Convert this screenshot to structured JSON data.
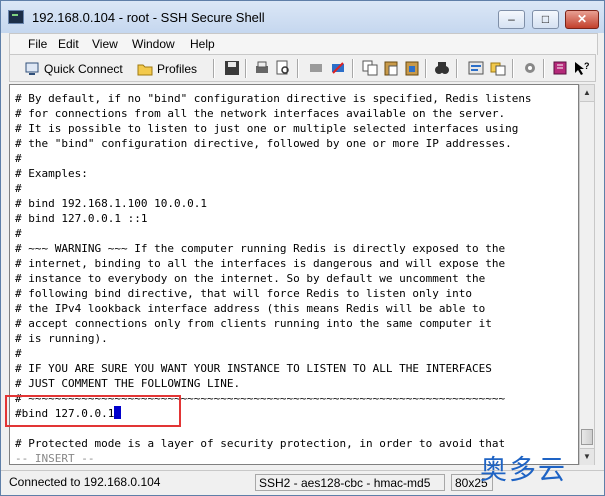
{
  "window": {
    "title": "192.168.0.104 - root - SSH Secure Shell",
    "controls": {
      "minimize": "–",
      "maximize": "□",
      "close": "✕"
    }
  },
  "menu": {
    "items": [
      "File",
      "Edit",
      "View",
      "Window",
      "Help"
    ]
  },
  "toolbar": {
    "quick_connect_label": "Quick Connect",
    "profiles_label": "Profiles",
    "icons": [
      "save-icon",
      "print-icon",
      "print-preview-icon",
      "disconnect-icon",
      "connect-icon",
      "copy-icon",
      "paste-icon",
      "paste-special-icon",
      "find-icon",
      "settings-icon",
      "file-transfer-icon",
      "options-icon",
      "help-book-icon",
      "context-help-icon"
    ]
  },
  "terminal": {
    "lines": [
      "# By default, if no \"bind\" configuration directive is specified, Redis listens",
      "# for connections from all the network interfaces available on the server.",
      "# It is possible to listen to just one or multiple selected interfaces using",
      "# the \"bind\" configuration directive, followed by one or more IP addresses.",
      "#",
      "# Examples:",
      "#",
      "# bind 192.168.1.100 10.0.0.1",
      "# bind 127.0.0.1 ::1",
      "#",
      "# ~~~ WARNING ~~~ If the computer running Redis is directly exposed to the",
      "# internet, binding to all the interfaces is dangerous and will expose the",
      "# instance to everybody on the internet. So by default we uncomment the",
      "# following bind directive, that will force Redis to listen only into",
      "# the IPv4 lookback interface address (this means Redis will be able to",
      "# accept connections only from clients running into the same computer it",
      "# is running).",
      "#",
      "# IF YOU ARE SURE YOU WANT YOUR INSTANCE TO LISTEN TO ALL THE INTERFACES",
      "# JUST COMMENT THE FOLLOWING LINE.",
      "# ~~~~~~~~~~~~~~~~~~~~~~~~~~~~~~~~~~~~~~~~~~~~~~~~~~~~~~~~~~~~~~~~~~~~~~~~",
      "#bind 127.0.0.1",
      "",
      "# Protected mode is a layer of security protection, in order to avoid that",
      "-- INSERT --"
    ],
    "cursor_line": "#bind 127.0.0.1"
  },
  "status": {
    "connection": "Connected to 192.168.0.104",
    "cipher": "SSH2 - aes128-cbc - hmac-md5",
    "size": "80x25"
  },
  "watermark": "奥多云",
  "colors": {
    "cursor": "#0000cc",
    "highlight_box": "#e23535",
    "watermark": "#1e63c4"
  }
}
